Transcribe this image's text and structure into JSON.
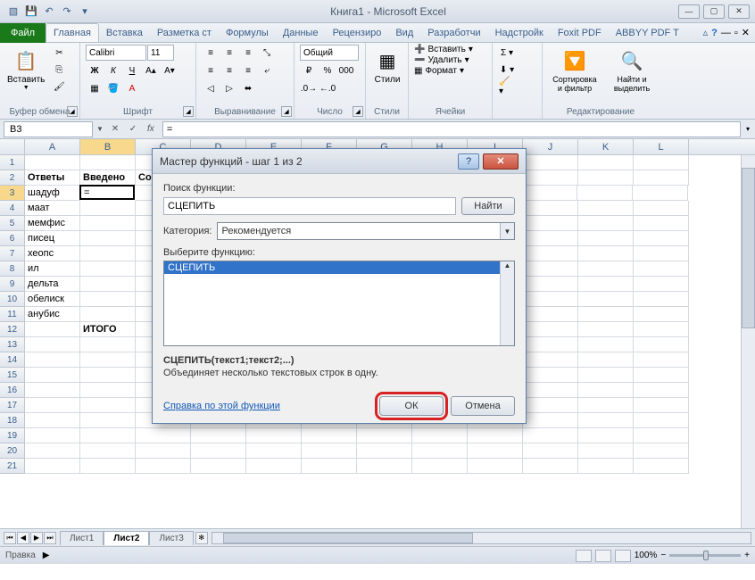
{
  "titlebar": {
    "title": "Книга1 - Microsoft Excel"
  },
  "ribbon": {
    "file_tab": "Файл",
    "tabs": [
      "Главная",
      "Вставка",
      "Разметка ст",
      "Формулы",
      "Данные",
      "Рецензиро",
      "Вид",
      "Разработчи",
      "Надстройк",
      "Foxit PDF",
      "ABBYY PDF T"
    ],
    "active_tab": 0,
    "groups": {
      "clipboard": {
        "label": "Буфер обмена",
        "paste": "Вставить"
      },
      "font": {
        "label": "Шрифт",
        "family": "Calibri",
        "size": "11"
      },
      "align": {
        "label": "Выравнивание"
      },
      "number": {
        "label": "Число",
        "format": "Общий"
      },
      "styles": {
        "label": "Стили",
        "styles_btn": "Стили"
      },
      "cells": {
        "label": "Ячейки",
        "insert": "Вставить",
        "delete": "Удалить",
        "format": "Формат"
      },
      "editing": {
        "label": "Редактирование",
        "sort": "Сортировка и фильтр",
        "find": "Найти и выделить"
      }
    }
  },
  "formula_bar": {
    "name_box": "B3",
    "formula": "="
  },
  "columns": [
    "A",
    "B",
    "C",
    "D",
    "E",
    "F",
    "G",
    "H",
    "I",
    "J",
    "K",
    "L"
  ],
  "active_cell": {
    "row": 3,
    "col": 1
  },
  "rows": [
    {
      "num": "1",
      "cells": [
        "",
        "",
        "",
        "",
        "",
        "",
        "",
        "",
        "",
        "",
        "",
        ""
      ]
    },
    {
      "num": "2",
      "cells": [
        "Ответы",
        "Введено",
        "Соот",
        "",
        "",
        "",
        "",
        "",
        "",
        "",
        "",
        ""
      ],
      "bold": true
    },
    {
      "num": "3",
      "cells": [
        "шадуф",
        "=",
        "",
        "",
        "",
        "",
        "",
        "",
        "",
        "",
        "",
        ""
      ]
    },
    {
      "num": "4",
      "cells": [
        "маат",
        "",
        "",
        "",
        "",
        "",
        "",
        "",
        "",
        "",
        "",
        ""
      ]
    },
    {
      "num": "5",
      "cells": [
        "мемфис",
        "",
        "",
        "",
        "",
        "",
        "",
        "",
        "",
        "",
        "",
        ""
      ]
    },
    {
      "num": "6",
      "cells": [
        "писец",
        "",
        "",
        "",
        "",
        "",
        "",
        "",
        "",
        "",
        "",
        ""
      ]
    },
    {
      "num": "7",
      "cells": [
        "хеопс",
        "",
        "",
        "",
        "",
        "",
        "",
        "",
        "",
        "",
        "",
        ""
      ]
    },
    {
      "num": "8",
      "cells": [
        "ил",
        "",
        "",
        "",
        "",
        "",
        "",
        "",
        "",
        "",
        "",
        ""
      ]
    },
    {
      "num": "9",
      "cells": [
        "дельта",
        "",
        "",
        "",
        "",
        "",
        "",
        "",
        "",
        "",
        "",
        ""
      ]
    },
    {
      "num": "10",
      "cells": [
        "обелиск",
        "",
        "",
        "",
        "",
        "",
        "",
        "",
        "",
        "",
        "",
        ""
      ]
    },
    {
      "num": "11",
      "cells": [
        "анубис",
        "",
        "",
        "",
        "",
        "",
        "",
        "",
        "",
        "",
        "",
        ""
      ]
    },
    {
      "num": "12",
      "cells": [
        "",
        "ИТОГО",
        "",
        "",
        "",
        "",
        "",
        "",
        "",
        "",
        "",
        ""
      ],
      "bold_cols": [
        1
      ]
    },
    {
      "num": "13",
      "cells": [
        "",
        "",
        "",
        "",
        "",
        "",
        "",
        "",
        "",
        "",
        "",
        ""
      ]
    },
    {
      "num": "14",
      "cells": [
        "",
        "",
        "",
        "",
        "",
        "",
        "",
        "",
        "",
        "",
        "",
        ""
      ]
    },
    {
      "num": "15",
      "cells": [
        "",
        "",
        "",
        "",
        "",
        "",
        "",
        "",
        "",
        "",
        "",
        ""
      ]
    },
    {
      "num": "16",
      "cells": [
        "",
        "",
        "",
        "",
        "",
        "",
        "",
        "",
        "",
        "",
        "",
        ""
      ]
    },
    {
      "num": "17",
      "cells": [
        "",
        "",
        "",
        "",
        "",
        "",
        "",
        "",
        "",
        "",
        "",
        ""
      ]
    },
    {
      "num": "18",
      "cells": [
        "",
        "",
        "",
        "",
        "",
        "",
        "",
        "",
        "",
        "",
        "",
        ""
      ]
    },
    {
      "num": "19",
      "cells": [
        "",
        "",
        "",
        "",
        "",
        "",
        "",
        "",
        "",
        "",
        "",
        ""
      ]
    },
    {
      "num": "20",
      "cells": [
        "",
        "",
        "",
        "",
        "",
        "",
        "",
        "",
        "",
        "",
        "",
        ""
      ]
    },
    {
      "num": "21",
      "cells": [
        "",
        "",
        "",
        "",
        "",
        "",
        "",
        "",
        "",
        "",
        "",
        ""
      ]
    }
  ],
  "sheets": {
    "tabs": [
      "Лист1",
      "Лист2",
      "Лист3"
    ],
    "active": 1
  },
  "status": {
    "mode": "Правка",
    "zoom": "100%"
  },
  "dialog": {
    "title": "Мастер функций - шаг 1 из 2",
    "search_label": "Поиск функции:",
    "search_value": "СЦЕПИТЬ",
    "find_btn": "Найти",
    "category_label": "Категория:",
    "category_value": "Рекомендуется",
    "select_label": "Выберите функцию:",
    "list_items": [
      "СЦЕПИТЬ"
    ],
    "signature": "СЦЕПИТЬ(текст1;текст2;...)",
    "description": "Объединяет несколько текстовых строк в одну.",
    "help_link": "Справка по этой функции",
    "ok_btn": "ОК",
    "cancel_btn": "Отмена"
  }
}
